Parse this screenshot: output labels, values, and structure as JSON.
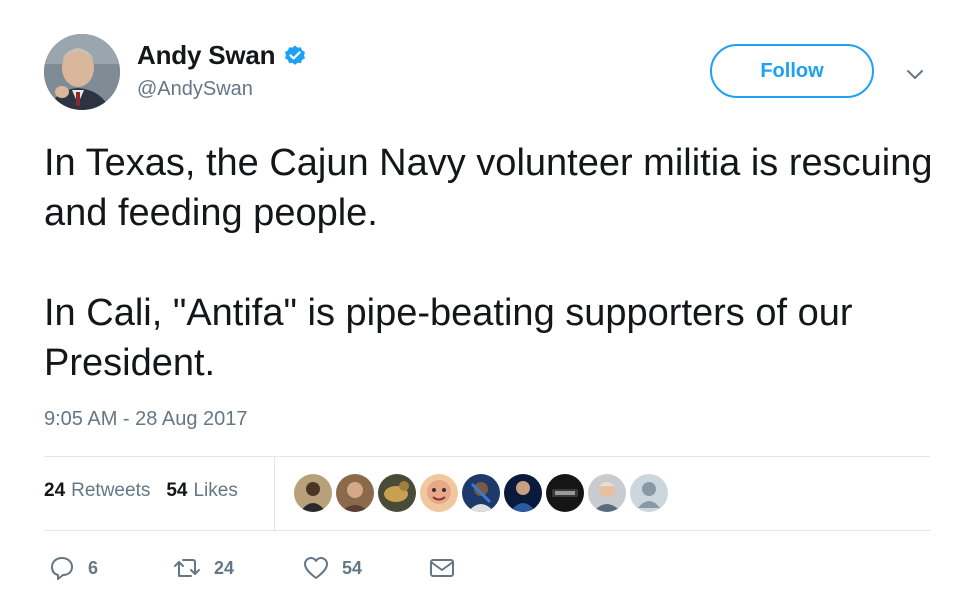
{
  "author": {
    "display_name": "Andy Swan",
    "handle": "@AndySwan",
    "verified": true
  },
  "header": {
    "follow_label": "Follow"
  },
  "tweet": {
    "paragraphs": [
      "In Texas, the Cajun Navy volunteer militia is rescuing and feeding people.",
      "In Cali, \"Antifa\" is pipe-beating supporters of our President."
    ],
    "timestamp": "9:05 AM - 28 Aug 2017"
  },
  "stats": {
    "retweets_count": "24",
    "retweets_label": "Retweets",
    "likes_count": "54",
    "likes_label": "Likes"
  },
  "actions": {
    "reply_count": "6",
    "retweet_count": "24",
    "like_count": "54"
  },
  "colors": {
    "accent": "#1da1f2",
    "secondary_text": "#657786",
    "divider": "#e1e8ed"
  },
  "icons": {
    "verified": "verified-badge-icon",
    "chevron": "chevron-down-icon",
    "reply": "reply-icon",
    "retweet": "retweet-icon",
    "like": "heart-icon",
    "message": "envelope-icon"
  }
}
